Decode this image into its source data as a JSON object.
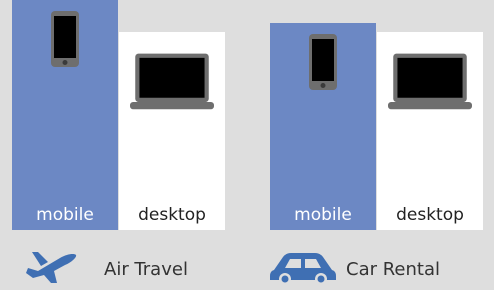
{
  "chart_data": {
    "type": "bar",
    "categories": [
      "Air Travel",
      "Car Rental"
    ],
    "series": [
      {
        "name": "mobile",
        "values": [
          100,
          90
        ]
      },
      {
        "name": "desktop",
        "values": [
          86,
          86
        ]
      }
    ],
    "ylim": [
      0,
      100
    ],
    "colors": {
      "mobile": "#6c88c4",
      "desktop": "#ffffff"
    },
    "bar_text_colors": {
      "mobile": "#ffffff",
      "desktop": "#222222"
    },
    "icons": {
      "Air Travel": "airplane-icon",
      "Car Rental": "car-icon",
      "mobile": "mobile-phone-icon",
      "desktop": "laptop-icon"
    },
    "icon_color": "#3f6fb3",
    "grid": false
  }
}
